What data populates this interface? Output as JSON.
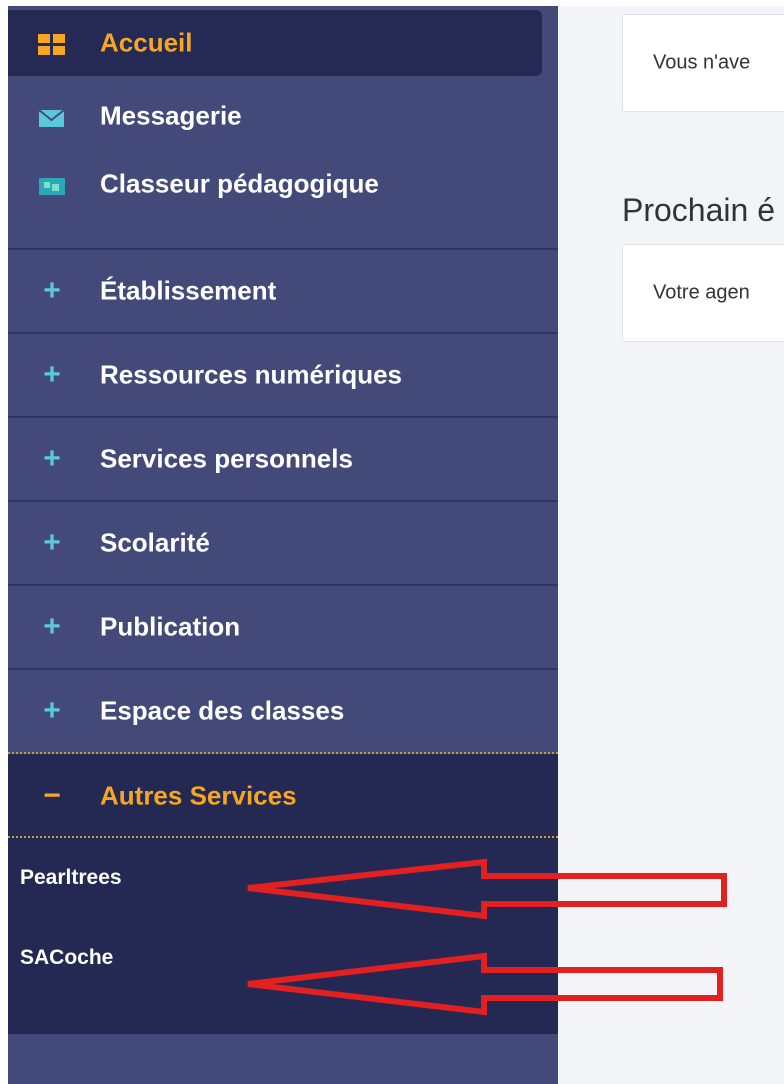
{
  "sidebar": {
    "accueil": "Accueil",
    "messagerie": "Messagerie",
    "classeur": "Classeur pédagogique",
    "sections": [
      "Établissement",
      "Ressources numériques",
      "Services personnels",
      "Scolarité",
      "Publication",
      "Espace des classes"
    ],
    "autres_services": "Autres Services",
    "sub_items": [
      "Pearltrees",
      "SACoche"
    ]
  },
  "main": {
    "card1_text": "Vous n'ave",
    "heading": "Prochain é",
    "card2_text": "Votre agen"
  },
  "colors": {
    "sidebar_bg": "#434a7a",
    "active_bg": "#252a54",
    "accent_orange": "#f6a623",
    "accent_cyan": "#5ac8d8",
    "annotation_red": "#e32020"
  }
}
